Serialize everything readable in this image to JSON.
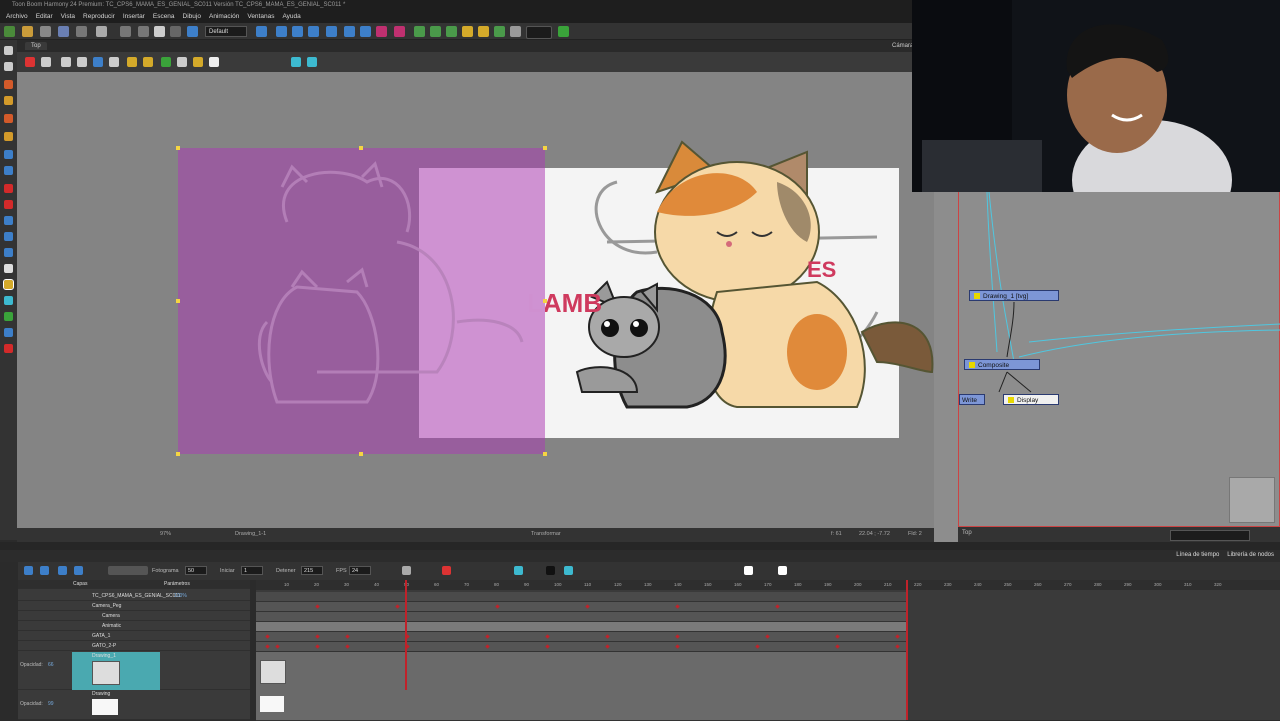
{
  "window": {
    "title": "Toon Boom Harmony 24 Premium: TC_CPS6_MAMA_ES_GENIAL_SC011 Versión TC_CPS6_MAMA_ES_GENIAL_SC011 *"
  },
  "menu": [
    "Archivo",
    "Editar",
    "Vista",
    "Reproducir",
    "Insertar",
    "Escena",
    "Dibujo",
    "Animación",
    "Ventanas",
    "Ayuda"
  ],
  "toolbar": {
    "layout_value": "Default"
  },
  "view": {
    "tab_label": "Top",
    "camera_label": "Cámara",
    "status_zoom": "97%",
    "status_drawing": "Drawing_1-1",
    "status_mode": "Transformar",
    "status_frame": "f: 61",
    "status_coords": "22.04 ; -7.72",
    "status_fields": "Fld: 2"
  },
  "artwork": {
    "left_text": "LAMB",
    "right_text": "ES"
  },
  "nodes": {
    "drawing": "Drawing_1 [tvg]",
    "composite": "Composite",
    "write": "Write",
    "display": "Display",
    "status_label": "Top"
  },
  "timeline": {
    "tabs": [
      "Línea de tiempo",
      "Librería de nodos"
    ],
    "frame_label": "Fotograma",
    "frame_value": "50",
    "start_label": "Iniciar",
    "start_value": "1",
    "stop_label": "Detener",
    "stop_value": "215",
    "fps_label": "FPS",
    "fps_value": "24",
    "col_capas": "Capas",
    "col_parametros": "Parámetros",
    "frame_ticks": [
      "10",
      "20",
      "30",
      "40",
      "50",
      "60",
      "70",
      "80",
      "90",
      "100",
      "110",
      "120",
      "130",
      "140",
      "150",
      "160",
      "170",
      "180",
      "190",
      "200",
      "210",
      "220",
      "230",
      "240",
      "250",
      "260",
      "270",
      "280",
      "290",
      "300",
      "310",
      "320"
    ],
    "opacity_label": "Opacidad",
    "opacity_value": "100%",
    "layers": [
      {
        "name": "TC_CPS6_MAMA_ES_GENIAL_SC011"
      },
      {
        "name": "Camera_Peg"
      },
      {
        "name": "Camera"
      },
      {
        "name": "Animatic"
      },
      {
        "name": "GATA_1"
      },
      {
        "name": "GATO_2-P"
      },
      {
        "name": "Drawing_1"
      },
      {
        "name": "Drawing"
      }
    ],
    "layer_opacity": "100%",
    "layer_opacity_label": "Opacidad:",
    "layer_opacity_value": "66",
    "layer2_opacity_value": "99"
  },
  "colors": {
    "accent": "#c0222a",
    "selection": "#4aa9b0",
    "node": "#7d96d6"
  }
}
